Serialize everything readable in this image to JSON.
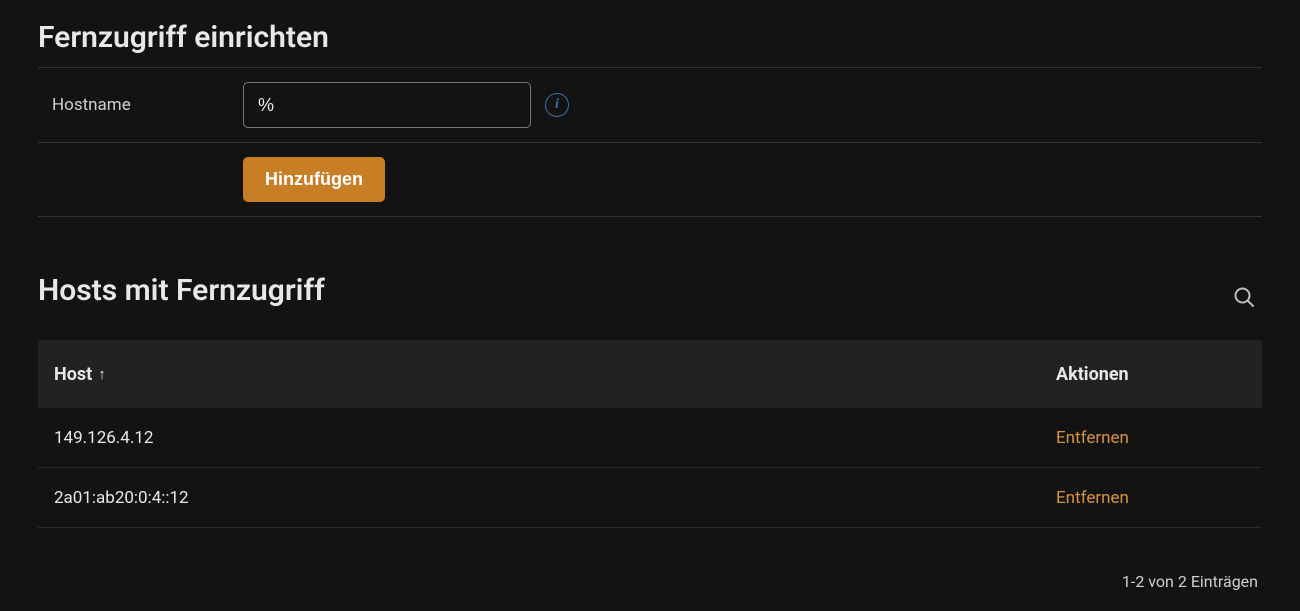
{
  "setup": {
    "title": "Fernzugriff einrichten",
    "hostname_label": "Hostname",
    "hostname_value": "%",
    "add_button": "Hinzufügen"
  },
  "list": {
    "title": "Hosts mit Fernzugriff",
    "columns": {
      "host": "Host",
      "actions": "Aktionen"
    },
    "sort_indicator": "↑",
    "remove_label": "Entfernen",
    "rows": [
      {
        "host": "149.126.4.12"
      },
      {
        "host": "2a01:ab20:0:4::12"
      }
    ],
    "pagination": "1-2 von 2 Einträgen"
  }
}
